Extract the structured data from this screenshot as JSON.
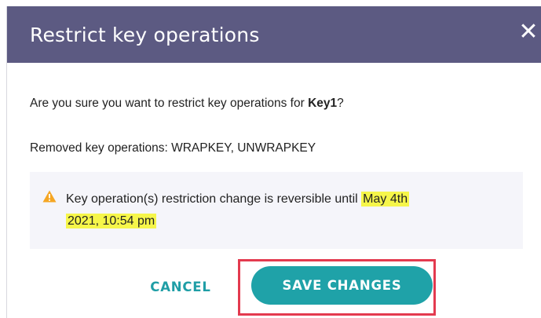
{
  "dialog": {
    "title": "Restrict key operations",
    "close_symbol": "✕",
    "confirm_prefix": "Are you sure you want to restrict key operations for ",
    "key_name": "Key1",
    "confirm_suffix": "?",
    "removed_operations": "Removed key operations: WRAPKEY, UNWRAPKEY",
    "notice": {
      "icon": "warning-icon",
      "text": "Key operation(s) restriction change is reversible until ",
      "deadline_part1": "May 4th",
      "deadline_part2": "2021, 10:54 pm"
    },
    "buttons": {
      "cancel": "CANCEL",
      "save": "SAVE CHANGES"
    }
  },
  "colors": {
    "header": "#5c5a82",
    "accent": "#1fa2a8",
    "highlight": "#f6f64a",
    "focus_outline": "#e33a4f",
    "warning": "#f5a623"
  }
}
